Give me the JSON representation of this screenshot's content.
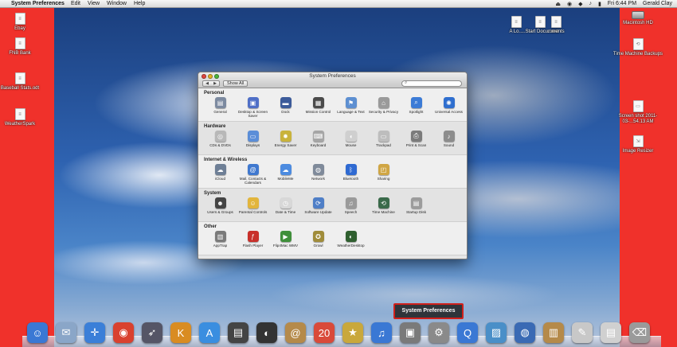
{
  "menubar": {
    "apple": "",
    "app_name": "System Preferences",
    "menus": [
      "Edit",
      "View",
      "Window",
      "Help"
    ],
    "clock": "Fri 6:44 PM",
    "user": "Gerald Clay",
    "status_icons": [
      "⏏",
      "◉",
      "◆",
      "♪",
      "▮"
    ]
  },
  "desktop_left": [
    {
      "label": "Ebay",
      "glyph": "≡"
    },
    {
      "label": "FNB Bank",
      "glyph": "≡"
    },
    {
      "label": "Baseball Stats.odt",
      "glyph": "≡"
    },
    {
      "label": "WeatherSpark",
      "glyph": "≡"
    }
  ],
  "desktop_top": [
    {
      "label": "A Lo...",
      "glyph": "≡"
    },
    {
      "label": "...Start Document",
      "glyph": "≡"
    },
    {
      "label": "...ments",
      "glyph": "≡"
    }
  ],
  "desktop_right": [
    {
      "label": "Macintosh HD",
      "glyph": ""
    },
    {
      "label": "Time Machine Backups",
      "glyph": "⟲"
    },
    {
      "label": "Screen shot 2011-03-...54.13 AM",
      "glyph": "▭"
    },
    {
      "label": "Image Resizer",
      "glyph": "⇲"
    }
  ],
  "window": {
    "title": "System Preferences",
    "back_forward": [
      "◀",
      "▶"
    ],
    "show_all": "Show All",
    "search_icon": "⌕",
    "sections": [
      {
        "label": "Personal",
        "items": [
          {
            "name": "General",
            "glyph": "▤",
            "color": "#7c8aa0"
          },
          {
            "name": "Desktop & Screen Saver",
            "glyph": "▣",
            "color": "#4f6fc7"
          },
          {
            "name": "Dock",
            "glyph": "▬",
            "color": "#3c5b9a"
          },
          {
            "name": "Mission Control",
            "glyph": "▦",
            "color": "#4a4a4a"
          },
          {
            "name": "Language & Text",
            "glyph": "⚑",
            "color": "#5d8fd1"
          },
          {
            "name": "Security & Privacy",
            "glyph": "⌂",
            "color": "#9a9a9a"
          },
          {
            "name": "Spotlight",
            "glyph": "⌕",
            "color": "#3c7bd6"
          },
          {
            "name": "Universal Access",
            "glyph": "✺",
            "color": "#2f6fcf"
          }
        ]
      },
      {
        "label": "Hardware",
        "items": [
          {
            "name": "CDs & DVDs",
            "glyph": "◎",
            "color": "#b8b8b8"
          },
          {
            "name": "Displays",
            "glyph": "▭",
            "color": "#5b8ed8"
          },
          {
            "name": "Energy Saver",
            "glyph": "✹",
            "color": "#c9b33b"
          },
          {
            "name": "Keyboard",
            "glyph": "⌨",
            "color": "#a6a6a6"
          },
          {
            "name": "Mouse",
            "glyph": "◖",
            "color": "#cfcfcf"
          },
          {
            "name": "Trackpad",
            "glyph": "▭",
            "color": "#bdbdbd"
          },
          {
            "name": "Print & Scan",
            "glyph": "⎙",
            "color": "#7b7b7b"
          },
          {
            "name": "Sound",
            "glyph": "♪",
            "color": "#8c8c8c"
          }
        ]
      },
      {
        "label": "Internet & Wireless",
        "items": [
          {
            "name": "iCloud",
            "glyph": "☁",
            "color": "#6e7f96"
          },
          {
            "name": "Mail, Contacts & Calendars",
            "glyph": "@",
            "color": "#3f78cf"
          },
          {
            "name": "MobileMe",
            "glyph": "☁",
            "color": "#4c8be0"
          },
          {
            "name": "Network",
            "glyph": "◍",
            "color": "#7f8a9a"
          },
          {
            "name": "Bluetooth",
            "glyph": "ᛒ",
            "color": "#2f6ad2"
          },
          {
            "name": "Sharing",
            "glyph": "◰",
            "color": "#d0a644"
          }
        ]
      },
      {
        "label": "System",
        "items": [
          {
            "name": "Users & Groups",
            "glyph": "☻",
            "color": "#444444"
          },
          {
            "name": "Parental Controls",
            "glyph": "☺",
            "color": "#e2b53c"
          },
          {
            "name": "Date & Time",
            "glyph": "◷",
            "color": "#d8d8d8"
          },
          {
            "name": "Software Update",
            "glyph": "⟳",
            "color": "#4f7fc7"
          },
          {
            "name": "Speech",
            "glyph": "♫",
            "color": "#9a9a9a"
          },
          {
            "name": "Time Machine",
            "glyph": "⟲",
            "color": "#3a6a4a"
          },
          {
            "name": "Startup Disk",
            "glyph": "▤",
            "color": "#9c9c9c"
          }
        ]
      },
      {
        "label": "Other",
        "items": [
          {
            "name": "AppTrap",
            "glyph": "▥",
            "color": "#7a7a7a"
          },
          {
            "name": "Flash Player",
            "glyph": "ƒ",
            "color": "#c8302a"
          },
          {
            "name": "Flip4Mac WMV",
            "glyph": "▶",
            "color": "#3f8f3a"
          },
          {
            "name": "Growl",
            "glyph": "✪",
            "color": "#a08c3a"
          },
          {
            "name": "WeatherDesktop",
            "glyph": "◐",
            "color": "#2f5f2f"
          }
        ]
      }
    ]
  },
  "dock": {
    "tooltip": "System Preferences",
    "items": [
      {
        "name": "Finder",
        "glyph": "☺",
        "color": "#3a78d4"
      },
      {
        "name": "Mail",
        "glyph": "✉",
        "color": "#8aa6c8"
      },
      {
        "name": "Safari",
        "glyph": "✛",
        "color": "#3b7fd8"
      },
      {
        "name": "Chrome",
        "glyph": "◉",
        "color": "#d9412f"
      },
      {
        "name": "Launchpad",
        "glyph": "➶",
        "color": "#555566"
      },
      {
        "name": "Kindle",
        "glyph": "K",
        "color": "#d98c22"
      },
      {
        "name": "App Store",
        "glyph": "A",
        "color": "#3a8ee0"
      },
      {
        "name": "Photo Booth",
        "glyph": "▤",
        "color": "#444444"
      },
      {
        "name": "Dashboard",
        "glyph": "◐",
        "color": "#333333"
      },
      {
        "name": "Address Book",
        "glyph": "@",
        "color": "#b58a4a"
      },
      {
        "name": "Calendar",
        "glyph": "20",
        "color": "#d94a3a"
      },
      {
        "name": "Stickies",
        "glyph": "★",
        "color": "#c9a83c"
      },
      {
        "name": "iTunes",
        "glyph": "♫",
        "color": "#3a78d4"
      },
      {
        "name": "iPhoto",
        "glyph": "▣",
        "color": "#7a7a7a"
      },
      {
        "name": "System Preferences",
        "glyph": "⚙",
        "color": "#8a8a8a"
      },
      {
        "name": "QuickTime",
        "glyph": "Q",
        "color": "#3a78d4"
      },
      {
        "name": "Preview",
        "glyph": "▨",
        "color": "#4a8fc8"
      },
      {
        "name": "Network Utility",
        "glyph": "◍",
        "color": "#3a6ab4"
      },
      {
        "name": "Archive",
        "glyph": "▥",
        "color": "#b58a4a"
      },
      {
        "name": "TextEdit",
        "glyph": "✎",
        "color": "#c8c8c8"
      },
      {
        "name": "Documents",
        "glyph": "▤",
        "color": "#d0d0d0"
      },
      {
        "name": "Trash",
        "glyph": "⌫",
        "color": "#9a9a9a"
      }
    ]
  }
}
